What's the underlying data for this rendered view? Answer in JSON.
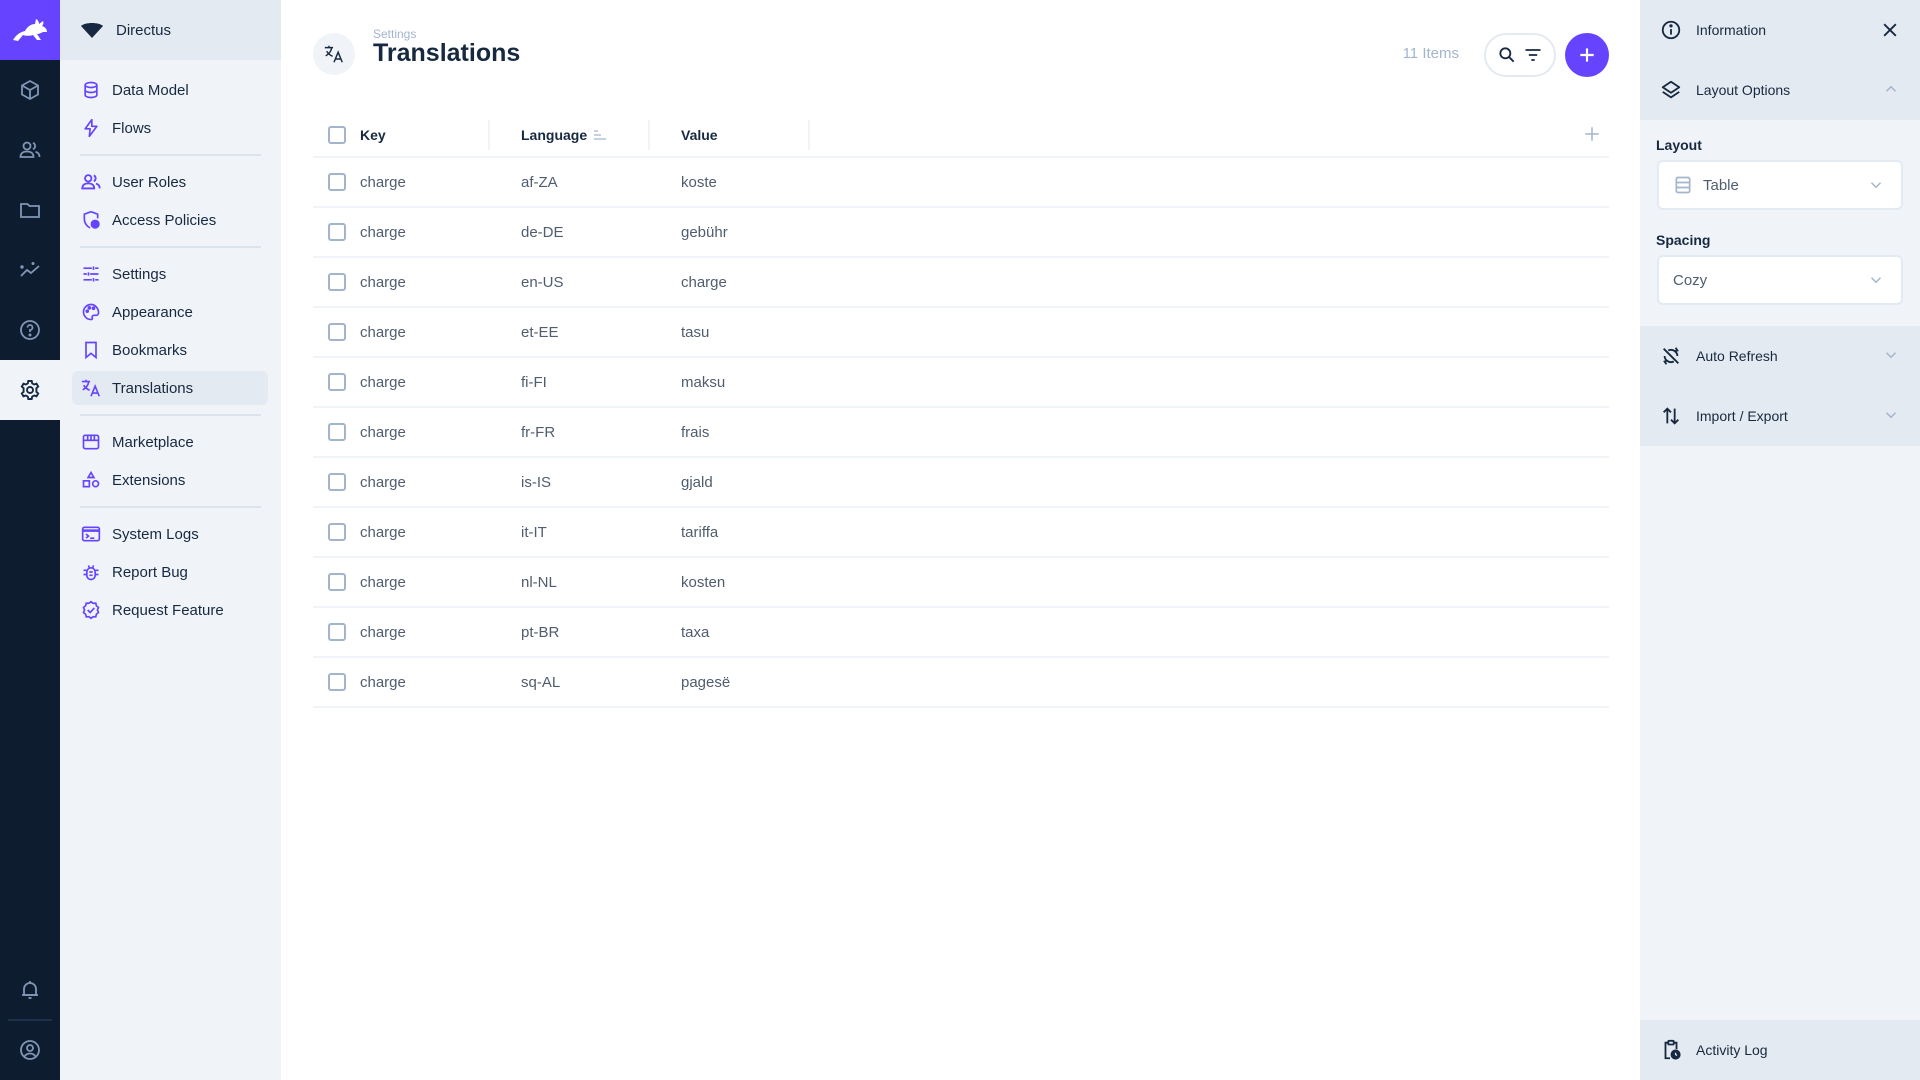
{
  "colors": {
    "accent": "#6644ff",
    "module_bar_bg": "#0e1c2f",
    "nav_bg": "#f0f4f9",
    "text_primary": "#172940",
    "text_muted": "#a2b5cd"
  },
  "module_bar": {
    "logo_icon": "directus-rabbit-logo",
    "items": [
      {
        "name": "content",
        "icon": "cube-icon"
      },
      {
        "name": "users",
        "icon": "users-icon"
      },
      {
        "name": "files",
        "icon": "folder-icon"
      },
      {
        "name": "insights",
        "icon": "insights-icon"
      },
      {
        "name": "help",
        "icon": "help-circle-icon"
      },
      {
        "name": "settings",
        "icon": "gear-icon",
        "active": true
      }
    ],
    "bottom": [
      {
        "name": "notifications",
        "icon": "bell-icon"
      },
      {
        "name": "user-profile",
        "icon": "user-avatar-icon"
      }
    ]
  },
  "nav": {
    "project_name": "Directus",
    "items": [
      {
        "label": "Data Model",
        "icon": "database-icon"
      },
      {
        "label": "Flows",
        "icon": "bolt-icon"
      },
      {
        "label": "User Roles",
        "icon": "users-icon"
      },
      {
        "label": "Access Policies",
        "icon": "shield-user-icon"
      },
      {
        "label": "Settings",
        "icon": "sliders-icon"
      },
      {
        "label": "Appearance",
        "icon": "palette-icon"
      },
      {
        "label": "Bookmarks",
        "icon": "bookmark-icon"
      },
      {
        "label": "Translations",
        "icon": "translate-icon",
        "active": true
      },
      {
        "label": "Marketplace",
        "icon": "storefront-icon"
      },
      {
        "label": "Extensions",
        "icon": "shapes-icon"
      },
      {
        "label": "System Logs",
        "icon": "terminal-icon"
      },
      {
        "label": "Report Bug",
        "icon": "bug-icon"
      },
      {
        "label": "Request Feature",
        "icon": "verified-check-icon"
      }
    ]
  },
  "header": {
    "breadcrumb": "Settings",
    "title": "Translations",
    "items_count": "11 Items"
  },
  "table": {
    "columns": [
      {
        "label": "Key"
      },
      {
        "label": "Language",
        "sorted": "ascending"
      },
      {
        "label": "Value"
      }
    ],
    "rows": [
      {
        "key": "charge",
        "language": "af-ZA",
        "value": "koste"
      },
      {
        "key": "charge",
        "language": "de-DE",
        "value": "gebühr"
      },
      {
        "key": "charge",
        "language": "en-US",
        "value": "charge"
      },
      {
        "key": "charge",
        "language": "et-EE",
        "value": "tasu"
      },
      {
        "key": "charge",
        "language": "fi-FI",
        "value": "maksu"
      },
      {
        "key": "charge",
        "language": "fr-FR",
        "value": "frais"
      },
      {
        "key": "charge",
        "language": "is-IS",
        "value": "gjald"
      },
      {
        "key": "charge",
        "language": "it-IT",
        "value": "tariffa"
      },
      {
        "key": "charge",
        "language": "nl-NL",
        "value": "kosten"
      },
      {
        "key": "charge",
        "language": "pt-BR",
        "value": "taxa"
      },
      {
        "key": "charge",
        "language": "sq-AL",
        "value": "pagesë"
      }
    ]
  },
  "sidebar": {
    "information_label": "Information",
    "layout_options_label": "Layout Options",
    "layout_label": "Layout",
    "layout_value": "Table",
    "spacing_label": "Spacing",
    "spacing_value": "Cozy",
    "auto_refresh_label": "Auto Refresh",
    "import_export_label": "Import / Export",
    "activity_log_label": "Activity Log"
  }
}
